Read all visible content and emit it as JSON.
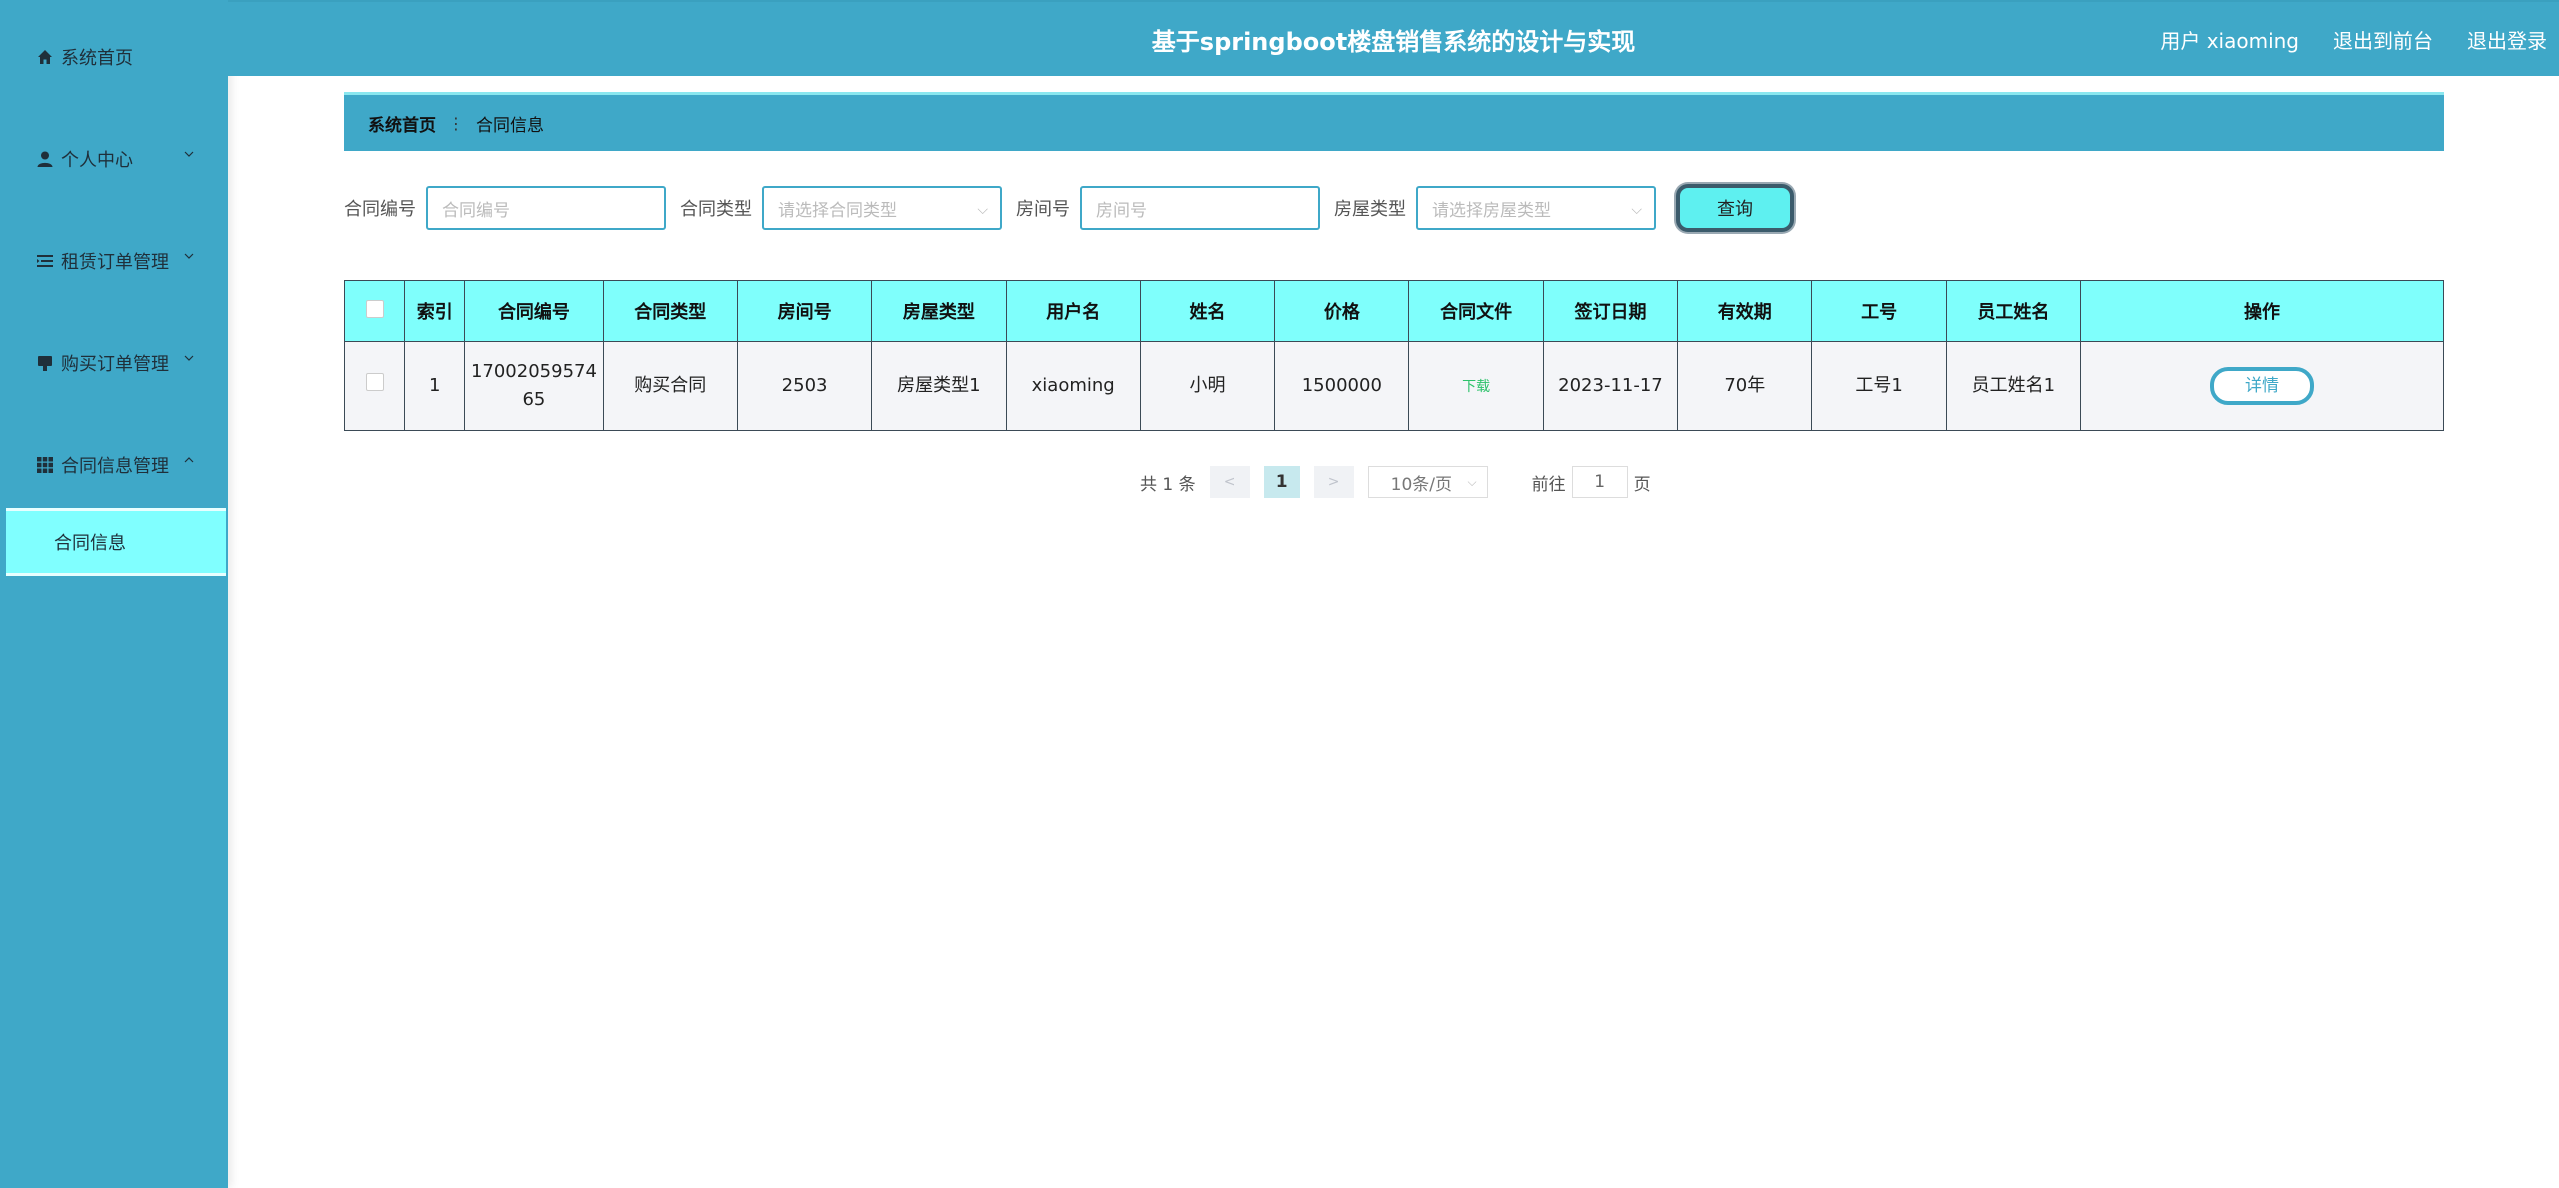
{
  "sidebar": {
    "items": [
      {
        "label": "系统首页",
        "icon": "home-icon"
      },
      {
        "label": "个人中心",
        "icon": "user-icon"
      },
      {
        "label": "租赁订单管理",
        "icon": "list-icon"
      },
      {
        "label": "购买订单管理",
        "icon": "order-icon"
      },
      {
        "label": "合同信息管理",
        "icon": "grid-icon"
      }
    ],
    "sub_active": "合同信息"
  },
  "header": {
    "title": "基于springboot楼盘销售系统的设计与实现",
    "user": "用户 xiaoming",
    "front": "退出到前台",
    "logout": "退出登录"
  },
  "breadcrumb": {
    "home": "系统首页",
    "current": "合同信息"
  },
  "search": {
    "contract_no_label": "合同编号",
    "contract_no_placeholder": "合同编号",
    "contract_type_label": "合同类型",
    "contract_type_placeholder": "请选择合同类型",
    "room_no_label": "房间号",
    "room_no_placeholder": "房间号",
    "house_type_label": "房屋类型",
    "house_type_placeholder": "请选择房屋类型",
    "query_label": "查询"
  },
  "table": {
    "headers": [
      "索引",
      "合同编号",
      "合同类型",
      "房间号",
      "房屋类型",
      "用户名",
      "姓名",
      "价格",
      "合同文件",
      "签订日期",
      "有效期",
      "工号",
      "员工姓名",
      "操作"
    ],
    "rows": [
      {
        "index": "1",
        "contract_no_1": "17002059574",
        "contract_no_2": "65",
        "contract_type": "购买合同",
        "room_no": "2503",
        "house_type": "房屋类型1",
        "username": "xiaoming",
        "name": "小明",
        "price": "1500000",
        "file": "下载",
        "sign_date": "2023-11-17",
        "validity": "70年",
        "emp_no": "工号1",
        "emp_name": "员工姓名1",
        "action": "详情"
      }
    ]
  },
  "pagination": {
    "total": "共 1 条",
    "prev": "<",
    "page": "1",
    "next": ">",
    "page_size": "10条/页",
    "goto_prefix": "前往",
    "goto_value": "1",
    "goto_suffix": "页"
  }
}
